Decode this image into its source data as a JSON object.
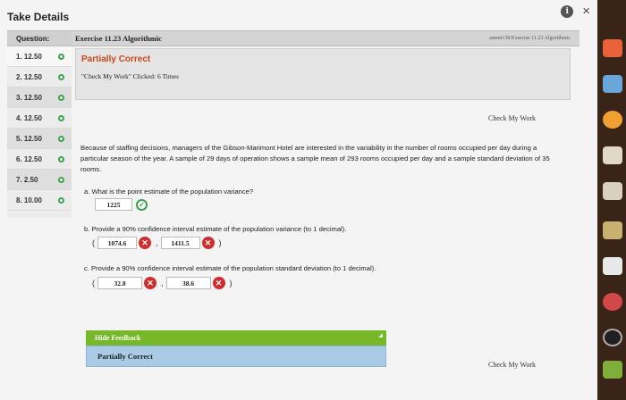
{
  "window": {
    "title": "Take Details",
    "info_icon": "info-icon",
    "close_icon": "close-icon",
    "info_glyph": "i",
    "close_glyph": "×"
  },
  "sidebar": {
    "header": "Question:",
    "items": [
      {
        "label": "1. 12.50"
      },
      {
        "label": "2. 12.50"
      },
      {
        "label": "3. 12.50"
      },
      {
        "label": "4. 12.50"
      },
      {
        "label": "5. 12.50"
      },
      {
        "label": "6. 12.50"
      },
      {
        "label": "7. 2.50"
      },
      {
        "label": "8. 10.00"
      }
    ]
  },
  "main": {
    "exercise_title": "Exercise 11.23 Algorithmic",
    "exercise_path": "asmm13h/Exercise 11.23 Algorithmic",
    "status_title": "Partially Correct",
    "clicked_text": "\"Check My Work\" Clicked: 6 Times",
    "check_my_work_top": "Check My Work",
    "check_my_work_bottom": "Check My Work",
    "question_text": "Because of staffing decisions, managers of the Gibson-Marimont Hotel are interested in the variability in the number of rooms occupied per day during a particular season of the year. A sample of 29 days of operation shows a sample mean of 293 rooms occupied per day and a sample standard deviation of 35 rooms.",
    "part_a": {
      "prompt": "a.  What is the point estimate of the population variance?",
      "answer": "1225"
    },
    "part_b": {
      "prompt": "b.  Provide a 90% confidence interval estimate of the population variance (to 1 decimal).",
      "lower": "1074.6",
      "upper": "1411.5"
    },
    "part_c": {
      "prompt": "c.  Provide a 90% confidence interval estimate of the population standard deviation (to 1 decimal).",
      "lower": "32.8",
      "upper": "38.6"
    },
    "open_paren": "(",
    "close_paren": ")",
    "comma": ",",
    "hide_feedback": "Hide Feedback",
    "feedback_status": "Partially Correct"
  },
  "colors": {
    "status_title": "#c8481a",
    "correct": "#38a34a",
    "incorrect": "#cf2e2e",
    "feedback_bar": "#76b82a",
    "feedback_box": "#a9cbe6"
  }
}
